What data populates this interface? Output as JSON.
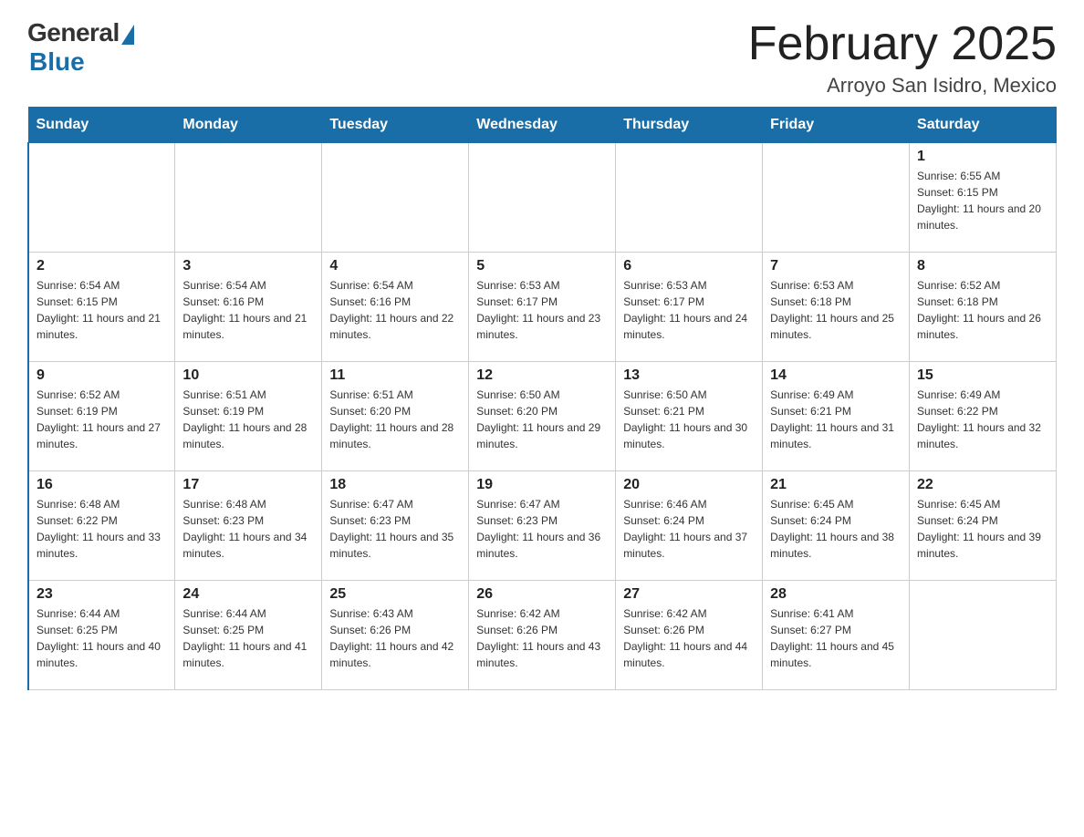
{
  "logo": {
    "general": "General",
    "blue": "Blue"
  },
  "title": "February 2025",
  "location": "Arroyo San Isidro, Mexico",
  "weekdays": [
    "Sunday",
    "Monday",
    "Tuesday",
    "Wednesday",
    "Thursday",
    "Friday",
    "Saturday"
  ],
  "weeks": [
    [
      {
        "day": "",
        "info": ""
      },
      {
        "day": "",
        "info": ""
      },
      {
        "day": "",
        "info": ""
      },
      {
        "day": "",
        "info": ""
      },
      {
        "day": "",
        "info": ""
      },
      {
        "day": "",
        "info": ""
      },
      {
        "day": "1",
        "info": "Sunrise: 6:55 AM\nSunset: 6:15 PM\nDaylight: 11 hours and 20 minutes."
      }
    ],
    [
      {
        "day": "2",
        "info": "Sunrise: 6:54 AM\nSunset: 6:15 PM\nDaylight: 11 hours and 21 minutes."
      },
      {
        "day": "3",
        "info": "Sunrise: 6:54 AM\nSunset: 6:16 PM\nDaylight: 11 hours and 21 minutes."
      },
      {
        "day": "4",
        "info": "Sunrise: 6:54 AM\nSunset: 6:16 PM\nDaylight: 11 hours and 22 minutes."
      },
      {
        "day": "5",
        "info": "Sunrise: 6:53 AM\nSunset: 6:17 PM\nDaylight: 11 hours and 23 minutes."
      },
      {
        "day": "6",
        "info": "Sunrise: 6:53 AM\nSunset: 6:17 PM\nDaylight: 11 hours and 24 minutes."
      },
      {
        "day": "7",
        "info": "Sunrise: 6:53 AM\nSunset: 6:18 PM\nDaylight: 11 hours and 25 minutes."
      },
      {
        "day": "8",
        "info": "Sunrise: 6:52 AM\nSunset: 6:18 PM\nDaylight: 11 hours and 26 minutes."
      }
    ],
    [
      {
        "day": "9",
        "info": "Sunrise: 6:52 AM\nSunset: 6:19 PM\nDaylight: 11 hours and 27 minutes."
      },
      {
        "day": "10",
        "info": "Sunrise: 6:51 AM\nSunset: 6:19 PM\nDaylight: 11 hours and 28 minutes."
      },
      {
        "day": "11",
        "info": "Sunrise: 6:51 AM\nSunset: 6:20 PM\nDaylight: 11 hours and 28 minutes."
      },
      {
        "day": "12",
        "info": "Sunrise: 6:50 AM\nSunset: 6:20 PM\nDaylight: 11 hours and 29 minutes."
      },
      {
        "day": "13",
        "info": "Sunrise: 6:50 AM\nSunset: 6:21 PM\nDaylight: 11 hours and 30 minutes."
      },
      {
        "day": "14",
        "info": "Sunrise: 6:49 AM\nSunset: 6:21 PM\nDaylight: 11 hours and 31 minutes."
      },
      {
        "day": "15",
        "info": "Sunrise: 6:49 AM\nSunset: 6:22 PM\nDaylight: 11 hours and 32 minutes."
      }
    ],
    [
      {
        "day": "16",
        "info": "Sunrise: 6:48 AM\nSunset: 6:22 PM\nDaylight: 11 hours and 33 minutes."
      },
      {
        "day": "17",
        "info": "Sunrise: 6:48 AM\nSunset: 6:23 PM\nDaylight: 11 hours and 34 minutes."
      },
      {
        "day": "18",
        "info": "Sunrise: 6:47 AM\nSunset: 6:23 PM\nDaylight: 11 hours and 35 minutes."
      },
      {
        "day": "19",
        "info": "Sunrise: 6:47 AM\nSunset: 6:23 PM\nDaylight: 11 hours and 36 minutes."
      },
      {
        "day": "20",
        "info": "Sunrise: 6:46 AM\nSunset: 6:24 PM\nDaylight: 11 hours and 37 minutes."
      },
      {
        "day": "21",
        "info": "Sunrise: 6:45 AM\nSunset: 6:24 PM\nDaylight: 11 hours and 38 minutes."
      },
      {
        "day": "22",
        "info": "Sunrise: 6:45 AM\nSunset: 6:24 PM\nDaylight: 11 hours and 39 minutes."
      }
    ],
    [
      {
        "day": "23",
        "info": "Sunrise: 6:44 AM\nSunset: 6:25 PM\nDaylight: 11 hours and 40 minutes."
      },
      {
        "day": "24",
        "info": "Sunrise: 6:44 AM\nSunset: 6:25 PM\nDaylight: 11 hours and 41 minutes."
      },
      {
        "day": "25",
        "info": "Sunrise: 6:43 AM\nSunset: 6:26 PM\nDaylight: 11 hours and 42 minutes."
      },
      {
        "day": "26",
        "info": "Sunrise: 6:42 AM\nSunset: 6:26 PM\nDaylight: 11 hours and 43 minutes."
      },
      {
        "day": "27",
        "info": "Sunrise: 6:42 AM\nSunset: 6:26 PM\nDaylight: 11 hours and 44 minutes."
      },
      {
        "day": "28",
        "info": "Sunrise: 6:41 AM\nSunset: 6:27 PM\nDaylight: 11 hours and 45 minutes."
      },
      {
        "day": "",
        "info": ""
      }
    ]
  ]
}
